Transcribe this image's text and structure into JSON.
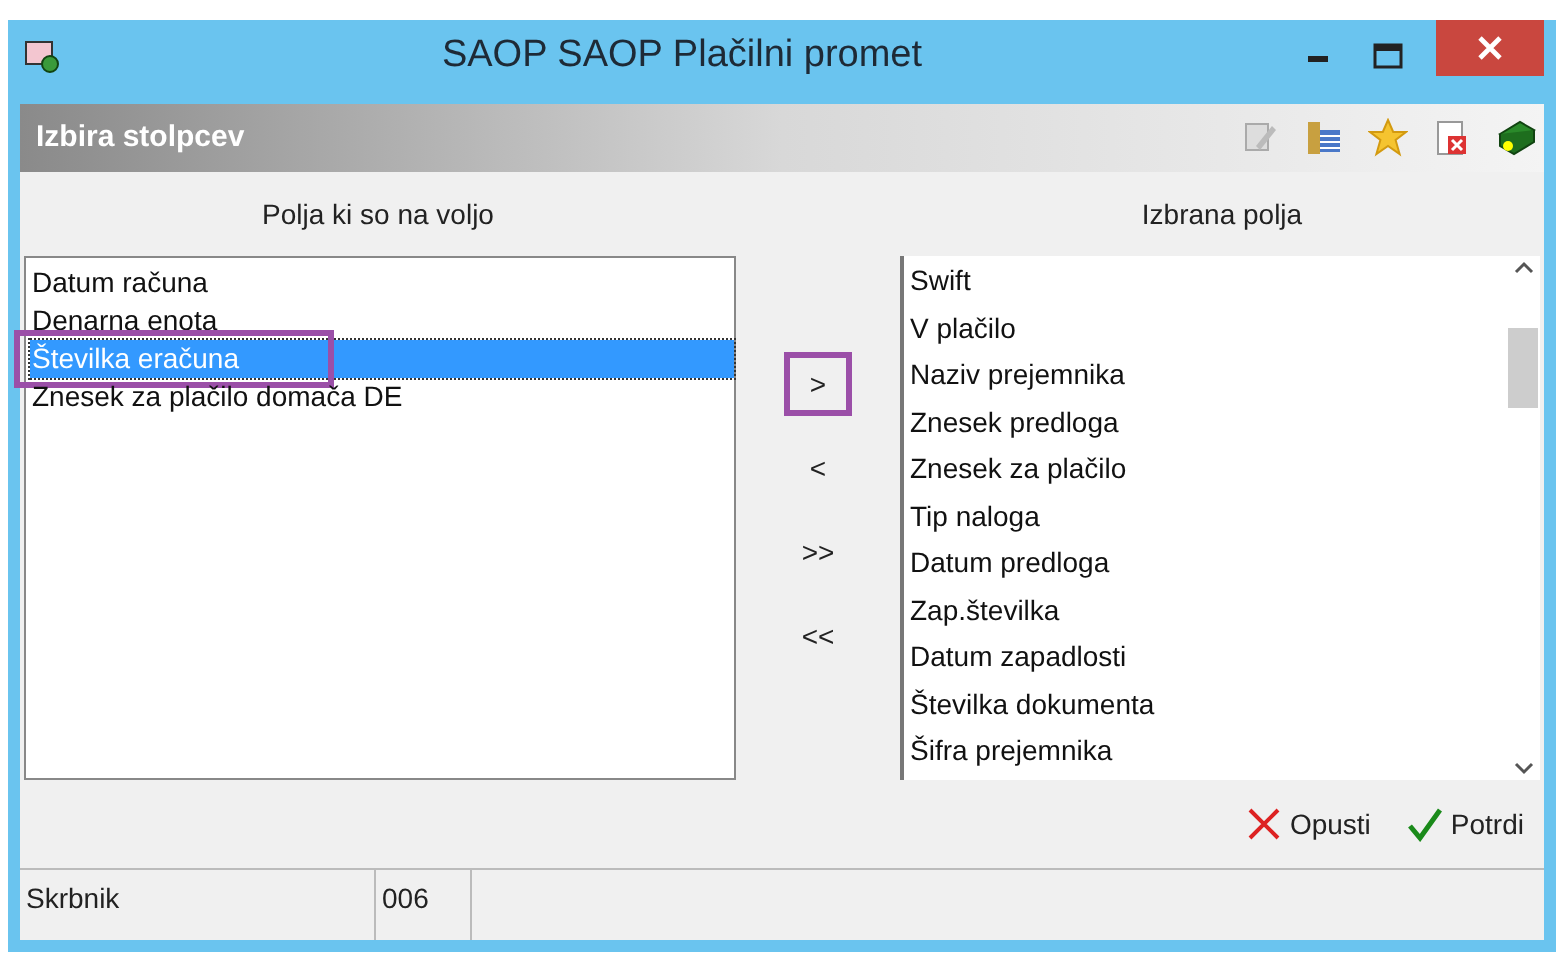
{
  "window": {
    "title": "SAOP SAOP Plačilni promet"
  },
  "panel": {
    "title": "Izbira stolpcev"
  },
  "toolbar": [
    {
      "kind": "edit"
    },
    {
      "kind": "columns"
    },
    {
      "kind": "star"
    },
    {
      "kind": "delete"
    },
    {
      "kind": "help"
    }
  ],
  "available": {
    "heading": "Polja ki so na voljo",
    "items": [
      {
        "label": "Datum računa",
        "selected": false,
        "highlighted": false
      },
      {
        "label": "Denarna enota",
        "selected": false,
        "highlighted": false
      },
      {
        "label": "Številka eračuna",
        "selected": true,
        "highlighted": true
      },
      {
        "label": "Znesek za plačilo domača DE",
        "selected": false,
        "highlighted": false
      }
    ]
  },
  "move_buttons": [
    {
      "label": ">",
      "highlighted": true
    },
    {
      "label": "<",
      "highlighted": false
    },
    {
      "label": ">>",
      "highlighted": false
    },
    {
      "label": "<<",
      "highlighted": false
    }
  ],
  "chosen": {
    "heading": "Izbrana polja",
    "items": [
      {
        "label": "Swift",
        "selected": false
      },
      {
        "label": "V plačilo",
        "selected": false
      },
      {
        "label": "Naziv prejemnika",
        "selected": false
      },
      {
        "label": "Znesek predloga",
        "selected": false
      },
      {
        "label": "Znesek za plačilo",
        "selected": false
      },
      {
        "label": "Tip naloga",
        "selected": false
      },
      {
        "label": "Datum predloga",
        "selected": false
      },
      {
        "label": "Zap.številka",
        "selected": false
      },
      {
        "label": "Datum zapadlosti",
        "selected": false
      },
      {
        "label": "Številka dokumenta",
        "selected": false
      },
      {
        "label": "Šifra prejemnika",
        "selected": false
      }
    ]
  },
  "actions": [
    {
      "kind": "cancel",
      "label": "Opusti"
    },
    {
      "kind": "confirm",
      "label": "Potrdi"
    }
  ],
  "status_bar": [
    "Skrbnik",
    "006"
  ]
}
